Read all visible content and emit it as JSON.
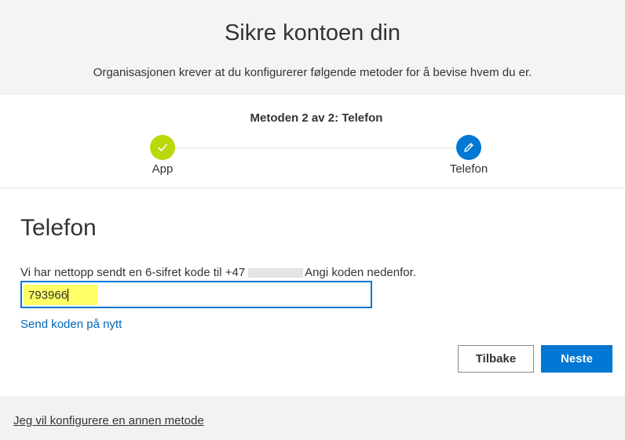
{
  "header": {
    "title": "Sikre kontoen din",
    "subtitle": "Organisasjonen krever at du konfigurerer følgende metoder for å bevise hvem du er."
  },
  "progress": {
    "step_label": "Metoden 2 av 2: Telefon",
    "steps": [
      {
        "label": "App",
        "state": "complete",
        "icon": "checkmark-icon"
      },
      {
        "label": "Telefon",
        "state": "active",
        "icon": "pencil-icon"
      }
    ]
  },
  "main": {
    "section_title": "Telefon",
    "info_prefix": "Vi har nettopp sendt en 6-sifret kode til +47",
    "info_suffix": "Angi koden nedenfor.",
    "code_value": "793966",
    "resend_link": "Send koden på nytt"
  },
  "buttons": {
    "back_label": "Tilbake",
    "next_label": "Neste"
  },
  "footer": {
    "alt_method_link": "Jeg vil konfigurere en annen metode"
  },
  "colors": {
    "accent": "#0078d4",
    "complete": "#bad80a",
    "highlight": "#ffff66",
    "link": "#0067b8"
  }
}
